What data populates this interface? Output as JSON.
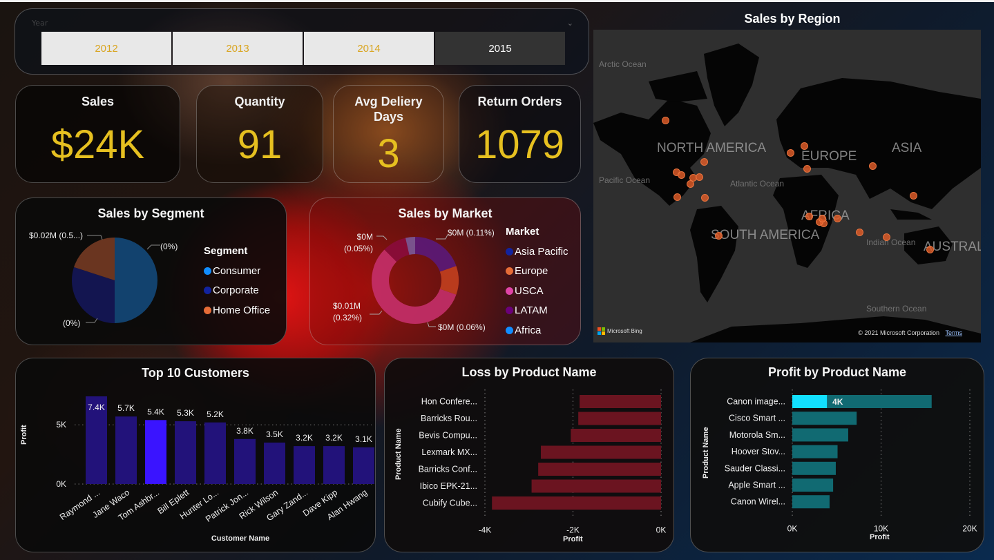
{
  "slicer": {
    "label": "Year",
    "chevron": "chevron-down-icon",
    "options": [
      "2012",
      "2013",
      "2014",
      "2015"
    ],
    "selected": "2015"
  },
  "kpis": {
    "sales": {
      "title": "Sales",
      "value": "$24K"
    },
    "quantity": {
      "title": "Quantity",
      "value": "91"
    },
    "avg_delivery": {
      "title": "Avg Deliery Days",
      "value": "3"
    },
    "return_orders": {
      "title": "Return Orders",
      "value": "1079"
    }
  },
  "colors": {
    "kpi_value": "#e6c020",
    "year_text": "#d9a520",
    "consumer": "#118dff",
    "corporate": "#12239e",
    "home_office": "#e66c37",
    "asia_pacific": "#12239e",
    "europe": "#e66c37",
    "usca": "#e044a7",
    "latam": "#6b007b",
    "africa": "#118dff",
    "customer_bar": "#22127a",
    "customer_bar_highlight": "#3a14ff",
    "loss_bar": "#6b1420",
    "profit_bar": "#116a72",
    "profit_bar_highlight": "#12e0ff"
  },
  "map": {
    "title": "Sales by Region",
    "oceans": [
      "Arctic Ocean",
      "Pacific Ocean",
      "Atlantic Ocean",
      "Indian Ocean",
      "Southern Ocean"
    ],
    "continents": [
      "NORTH AMERICA",
      "EUROPE",
      "ASIA",
      "AFRICA",
      "SOUTH AMERICA",
      "AUSTRAL"
    ],
    "attribution": "Microsoft Bing",
    "copyright": "© 2021 Microsoft Corporation",
    "terms": "Terms"
  },
  "chart_data": [
    {
      "type": "pie",
      "title": "Sales by Segment",
      "legend_title": "Segment",
      "legend": "right",
      "categories": [
        "Consumer",
        "Corporate",
        "Home Office"
      ],
      "values": [
        50,
        30,
        20
      ],
      "data_labels": [
        "(0%)",
        "(0%)",
        "$0.02M (0.5...)"
      ]
    },
    {
      "type": "pie",
      "subtype": "donut",
      "title": "Sales by Market",
      "legend_title": "Market",
      "legend": "right",
      "categories": [
        "Asia Pacific",
        "Europe",
        "USCA",
        "LATAM",
        "Africa"
      ],
      "values": [
        0.11,
        0.06,
        0.32,
        0.05,
        0.02
      ],
      "data_labels": [
        "$0M (0.11%)",
        "$0M (0.06%)",
        "$0.01M (0.32%)",
        "$0M (0.05%)",
        ""
      ]
    },
    {
      "type": "bar",
      "title": "Top 10 Customers",
      "xlabel": "Customer Name",
      "ylabel": "Profit",
      "ylim": [
        0,
        7400
      ],
      "yticks": [
        "0K",
        "5K"
      ],
      "categories": [
        "Raymond ...",
        "Jane Waco",
        "Tom Ashbr...",
        "Bill Eplett",
        "Hunter Lo...",
        "Patrick Jon...",
        "Rick Wilson",
        "Gary Zand...",
        "Dave Kipp",
        "Alan Hwang"
      ],
      "values": [
        7400,
        5700,
        5400,
        5300,
        5200,
        3800,
        3500,
        3200,
        3200,
        3100
      ],
      "data_labels": [
        "7.4K",
        "5.7K",
        "5.4K",
        "5.3K",
        "5.2K",
        "3.8K",
        "3.5K",
        "3.2K",
        "3.2K",
        "3.1K"
      ],
      "highlighted_index": 2
    },
    {
      "type": "bar",
      "orientation": "horizontal",
      "title": "Loss by Product Name",
      "xlabel": "Profit",
      "ylabel": "Product Name",
      "xlim": [
        -4000,
        0
      ],
      "xticks": [
        "-4K",
        "-2K",
        "0K"
      ],
      "categories": [
        "Hon Confere...",
        "Barricks Rou...",
        "Bevis Compu...",
        "Lexmark MX...",
        "Barricks Conf...",
        "Ibico EPK-21...",
        "Cubify Cube..."
      ],
      "values": [
        -1850,
        -1880,
        -2050,
        -2730,
        -2790,
        -2940,
        -3840
      ]
    },
    {
      "type": "bar",
      "orientation": "horizontal",
      "title": "Profit by Product Name",
      "xlabel": "Profit",
      "ylabel": "Product Name",
      "xlim": [
        0,
        20000
      ],
      "xticks": [
        "0K",
        "10K",
        "20K"
      ],
      "categories": [
        "Canon image...",
        "Cisco Smart ...",
        "Motorola Sm...",
        "Hoover Stov...",
        "Sauder Classi...",
        "Apple Smart ...",
        "Canon Wirel..."
      ],
      "values": [
        15700,
        7250,
        6300,
        5100,
        4900,
        4600,
        4200
      ],
      "highlight": {
        "index": 0,
        "value": 3900,
        "label": "4K"
      }
    }
  ]
}
